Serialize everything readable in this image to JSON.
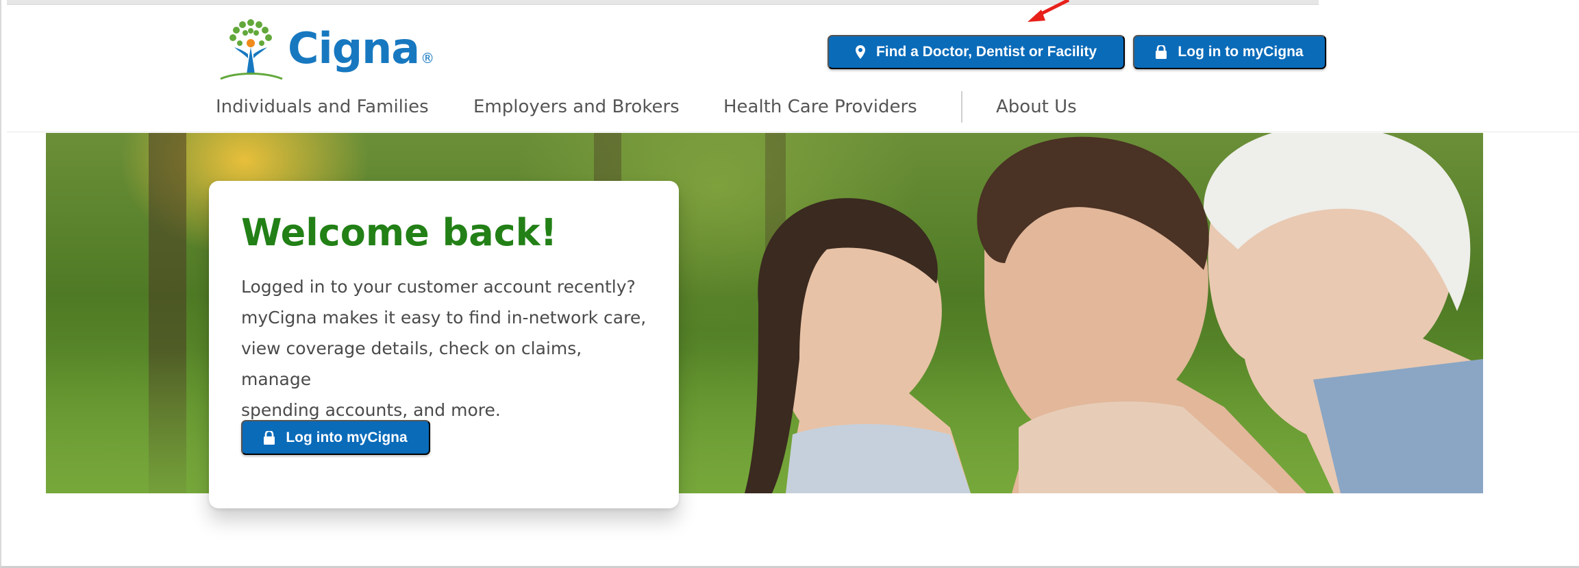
{
  "brand": {
    "name": "Cigna",
    "reg_mark": "®",
    "color": "#1778c0",
    "tree_green": "#62a83b",
    "tree_orange": "#f08a1c"
  },
  "header": {
    "find_button": {
      "label": "Find a Doctor, Dentist or Facility",
      "icon": "map-pin-icon"
    },
    "login_button": {
      "label": "Log in to myCigna",
      "icon": "lock-icon"
    },
    "nav": [
      {
        "label": "Individuals and Families"
      },
      {
        "label": "Employers and Brokers"
      },
      {
        "label": "Health Care Providers"
      },
      {
        "label": "About Us"
      }
    ]
  },
  "welcome_card": {
    "title": "Welcome back!",
    "lines": [
      "Logged in to your customer account recently?",
      "myCigna makes it easy to find in-network care,",
      "view coverage details, check on claims, manage",
      "spending accounts, and more."
    ],
    "button": {
      "label": "Log into myCigna",
      "icon": "lock-icon"
    }
  },
  "colors": {
    "primary_button": "#0a6bb9",
    "title_green": "#228016",
    "annotation_red": "#e8201a"
  }
}
